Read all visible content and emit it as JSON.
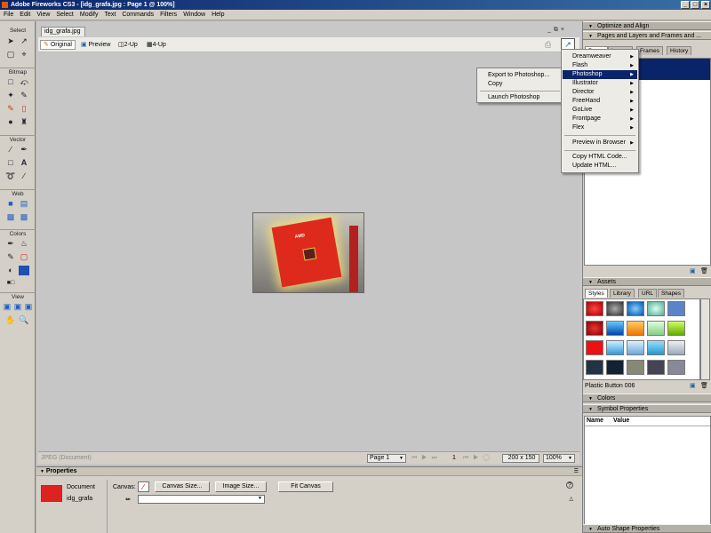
{
  "window": {
    "title": "Adobe Fireworks CS3 - [idg_grafa.jpg : Page 1 @ 100%]"
  },
  "menubar": [
    "File",
    "Edit",
    "View",
    "Select",
    "Modify",
    "Text",
    "Commands",
    "Filters",
    "Window",
    "Help"
  ],
  "tools": {
    "select": "Select",
    "bitmap": "Bitmap",
    "vector": "Vector",
    "web": "Web",
    "colors": "Colors",
    "view": "View"
  },
  "document": {
    "tab": "idg_grafa.jpg",
    "views": [
      "Original",
      "Preview",
      "2-Up",
      "4-Up"
    ],
    "image_label": "AMD",
    "status_left": "JPEG (Document)",
    "page": "Page 1",
    "frame": "1",
    "size": "200 x 150",
    "zoom": "100%"
  },
  "properties": {
    "title": "Properties",
    "doc_label": "Document",
    "doc_name": "idg_grafa",
    "canvas_label": "Canvas:",
    "buttons": [
      "Canvas Size...",
      "Image Size...",
      "Fit Canvas"
    ]
  },
  "panels": {
    "optimize": "Optimize and Align",
    "pages_title": "Pages and Layers and Frames and ...",
    "pages_tabs": [
      "Pages",
      "Layers",
      "Frames",
      "History"
    ],
    "assets": "Assets",
    "asset_tabs": [
      "Styles",
      "Library",
      "URL",
      "Shapes"
    ],
    "style_name": "Plastic Button 006",
    "colors": "Colors",
    "symbol": "Symbol Properties",
    "symbol_cols": [
      "Name",
      "Value"
    ],
    "auto_shape": "Auto Shape Properties"
  },
  "menu_quickexport": {
    "items": [
      "Export to Photoshop...",
      "Copy",
      "Launch Photoshop"
    ]
  },
  "menu_apps": {
    "items": [
      "Dreamweaver",
      "Flash",
      "Photoshop",
      "Illustrator",
      "Director",
      "FreeHand",
      "GoLive",
      "Frontpage",
      "Flex",
      "Preview in Browser",
      "Copy HTML Code...",
      "Update HTML..."
    ],
    "highlighted": "Photoshop"
  },
  "colors": {
    "titlebar": "#0a246a",
    "accent": "#0a246a",
    "chip": "#de2a1c"
  },
  "icons": {
    "quick_export": "export-icon",
    "minimize": "minimize-icon",
    "restore": "restore-icon",
    "close": "close-icon"
  }
}
